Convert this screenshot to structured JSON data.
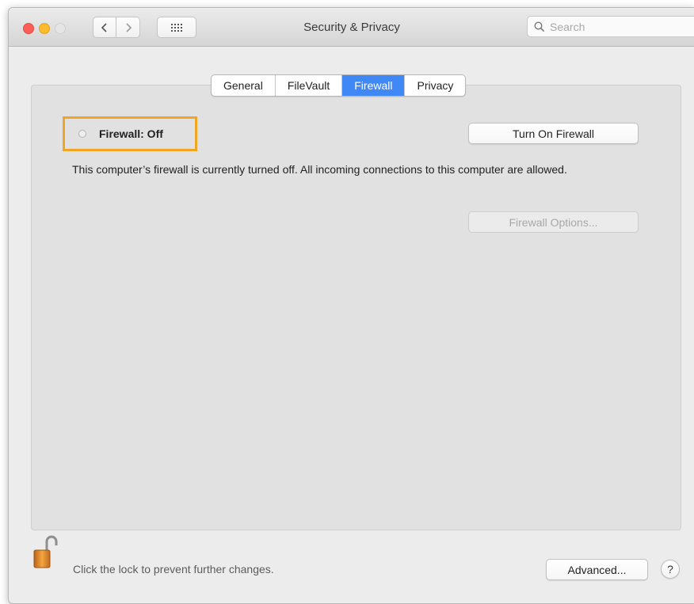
{
  "window": {
    "title": "Security & Privacy"
  },
  "search": {
    "placeholder": "Search"
  },
  "tabs": [
    {
      "label": "General",
      "active": false
    },
    {
      "label": "FileVault",
      "active": false
    },
    {
      "label": "Firewall",
      "active": true
    },
    {
      "label": "Privacy",
      "active": false
    }
  ],
  "firewall": {
    "status_label": "Firewall: Off",
    "turn_on_button": "Turn On Firewall",
    "description": "This computer’s firewall is currently turned off. All incoming connections to this computer are allowed.",
    "options_button": "Firewall Options...",
    "highlight_color": "#f0a623"
  },
  "footer": {
    "lock_message": "Click the lock to prevent further changes.",
    "advanced_button": "Advanced...",
    "help_label": "?"
  },
  "icons": {
    "nav_back": "chevron-left-icon",
    "nav_forward": "chevron-right-icon",
    "show_all": "grid-icon",
    "search": "search-icon",
    "lock": "lock-open-icon"
  },
  "colors": {
    "accent": "#3f88f5",
    "close": "#fc5f57",
    "minimize": "#fdbc2e"
  }
}
